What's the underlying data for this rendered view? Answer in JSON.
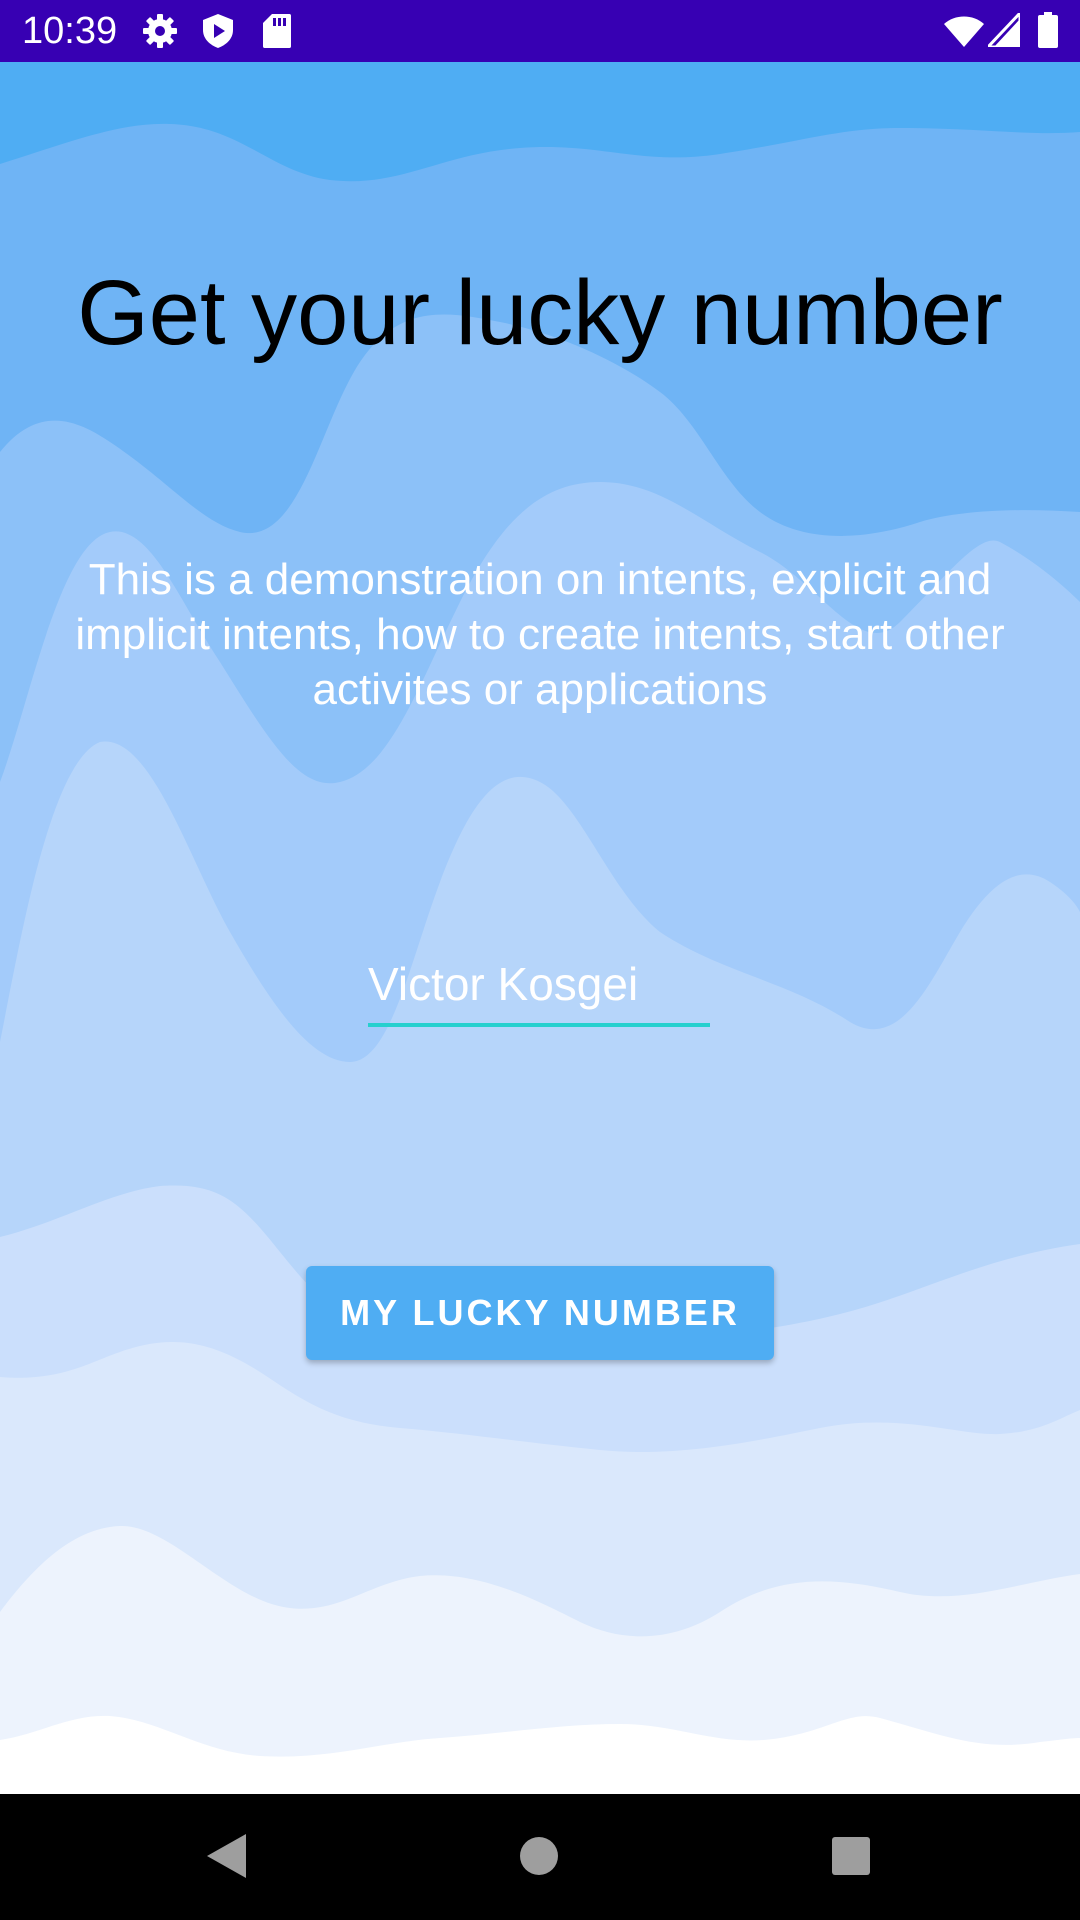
{
  "status_bar": {
    "time": "10:39",
    "left_icons": [
      "settings-icon",
      "shield-play-icon",
      "sd-card-icon"
    ],
    "right_icons": [
      "wifi-icon",
      "signal-icon",
      "battery-icon"
    ],
    "background": "#3700b3"
  },
  "main": {
    "title": "Get your lucky number",
    "description": "This is a demonstration on intents, explicit and implicit intents, how to create intents, start other activites or applications",
    "name_input": {
      "value": "Victor Kosgei",
      "underline_color": "#26d0ce"
    },
    "button": {
      "label": "MY LUCKY NUMBER",
      "color": "#4fadf3"
    },
    "background_colors": [
      "#4fadf3",
      "#6fb4f5",
      "#8cc1f8",
      "#a3cbfa",
      "#b6d5fa",
      "#cbdffc",
      "#dae8fc",
      "#edf3fd",
      "#ffffff"
    ]
  },
  "nav_bar": {
    "buttons": [
      "back-icon",
      "home-icon",
      "recents-icon"
    ]
  }
}
